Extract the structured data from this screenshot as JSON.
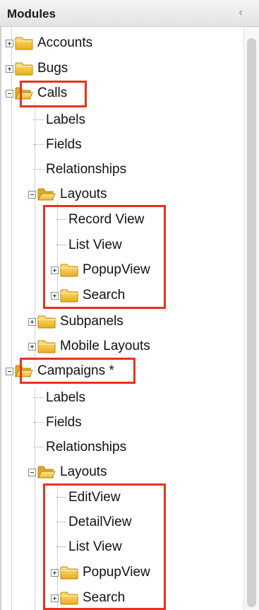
{
  "panel": {
    "title": "Modules",
    "collapse_glyph": "‹"
  },
  "tree": {
    "accounts": "Accounts",
    "bugs": "Bugs",
    "calls": {
      "label": "Calls",
      "labels": "Labels",
      "fields": "Fields",
      "relationships": "Relationships",
      "layouts": "Layouts",
      "record_view": "Record View",
      "list_view": "List View",
      "popup_view": "PopupView",
      "search": "Search",
      "subpanels": "Subpanels",
      "mobile_layouts": "Mobile Layouts"
    },
    "campaigns": {
      "label": "Campaigns *",
      "labels": "Labels",
      "fields": "Fields",
      "relationships": "Relationships",
      "layouts": "Layouts",
      "edit_view": "EditView",
      "detail_view": "DetailView",
      "list_view": "List View",
      "popup_view": "PopupView",
      "search": "Search"
    }
  },
  "icons": {
    "folder_closed": "folder-icon",
    "folder_open": "folder-open-icon",
    "expand": "plus-expander-icon",
    "collapse": "minus-expander-icon"
  },
  "colors": {
    "highlight": "#e8321e",
    "folder": "#f2c12e"
  }
}
